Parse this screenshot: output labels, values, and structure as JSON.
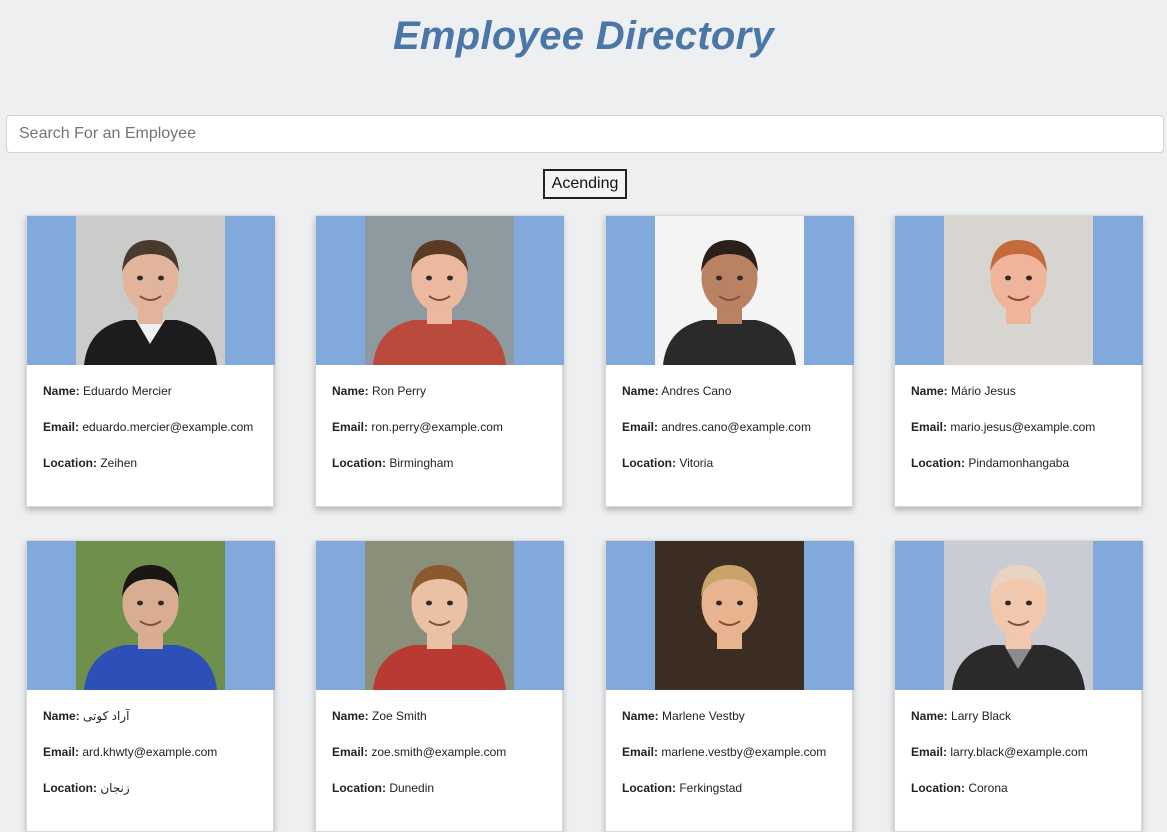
{
  "header": {
    "title": "Employee Directory"
  },
  "search": {
    "placeholder": "Search For an Employee",
    "value": ""
  },
  "sort": {
    "label": "Acending"
  },
  "labels": {
    "name": "Name:",
    "email": "Email:",
    "location": "Location:"
  },
  "colors": {
    "accent": "#4a76a8",
    "photo_band": "#82a9dc",
    "background": "#eeeff1"
  },
  "employees": [
    {
      "name": "Eduardo Mercier",
      "email": "eduardo.mercier@example.com",
      "location": "Zeihen"
    },
    {
      "name": "Ron Perry",
      "email": "ron.perry@example.com",
      "location": "Birmingham"
    },
    {
      "name": "Andres Cano",
      "email": "andres.cano@example.com",
      "location": "Vitoria"
    },
    {
      "name": "Mário Jesus",
      "email": "mario.jesus@example.com",
      "location": "Pindamonhangaba"
    },
    {
      "name": "آراد کوتی",
      "email": "ard.khwty@example.com",
      "location": "زنجان"
    },
    {
      "name": "Zoe Smith",
      "email": "zoe.smith@example.com",
      "location": "Dunedin"
    },
    {
      "name": "Marlene Vestby",
      "email": "marlene.vestby@example.com",
      "location": "Ferkingstad"
    },
    {
      "name": "Larry Black",
      "email": "larry.black@example.com",
      "location": "Corona"
    }
  ]
}
